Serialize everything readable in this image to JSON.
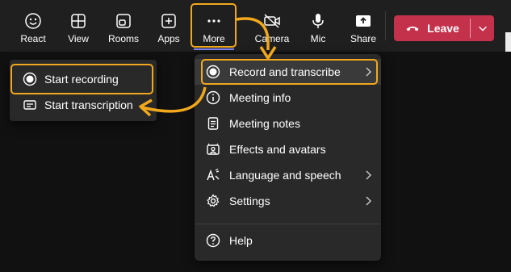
{
  "toolbar": {
    "react": {
      "label": "React",
      "icon": "smiley-icon"
    },
    "view": {
      "label": "View",
      "icon": "grid-icon"
    },
    "rooms": {
      "label": "Rooms",
      "icon": "rooms-icon"
    },
    "apps": {
      "label": "Apps",
      "icon": "add-app-icon"
    },
    "more": {
      "label": "More",
      "icon": "ellipsis-icon"
    },
    "camera": {
      "label": "Camera",
      "icon": "camera-off-icon"
    },
    "mic": {
      "label": "Mic",
      "icon": "microphone-icon"
    },
    "share": {
      "label": "Share",
      "icon": "share-screen-icon"
    },
    "leave": {
      "label": "Leave",
      "icon": "hang-up-icon"
    }
  },
  "menu": {
    "items": [
      {
        "label": "Record and transcribe",
        "icon": "record-icon",
        "has_submenu": true
      },
      {
        "label": "Meeting info",
        "icon": "info-icon",
        "has_submenu": false
      },
      {
        "label": "Meeting notes",
        "icon": "notes-icon",
        "has_submenu": false
      },
      {
        "label": "Effects and avatars",
        "icon": "effects-icon",
        "has_submenu": false
      },
      {
        "label": "Language and speech",
        "icon": "language-icon",
        "has_submenu": true
      },
      {
        "label": "Settings",
        "icon": "gear-icon",
        "has_submenu": true
      },
      {
        "label": "Help",
        "icon": "help-icon",
        "has_submenu": false
      }
    ]
  },
  "submenu": {
    "items": [
      {
        "label": "Start recording",
        "icon": "record-icon"
      },
      {
        "label": "Start transcription",
        "icon": "transcript-icon"
      }
    ]
  },
  "colors": {
    "toolbar_bg": "#1f1f1f",
    "menu_bg": "#292929",
    "leave_red": "#c4314b",
    "highlight_orange": "#f2a81d",
    "accent": "#7f85f5"
  }
}
